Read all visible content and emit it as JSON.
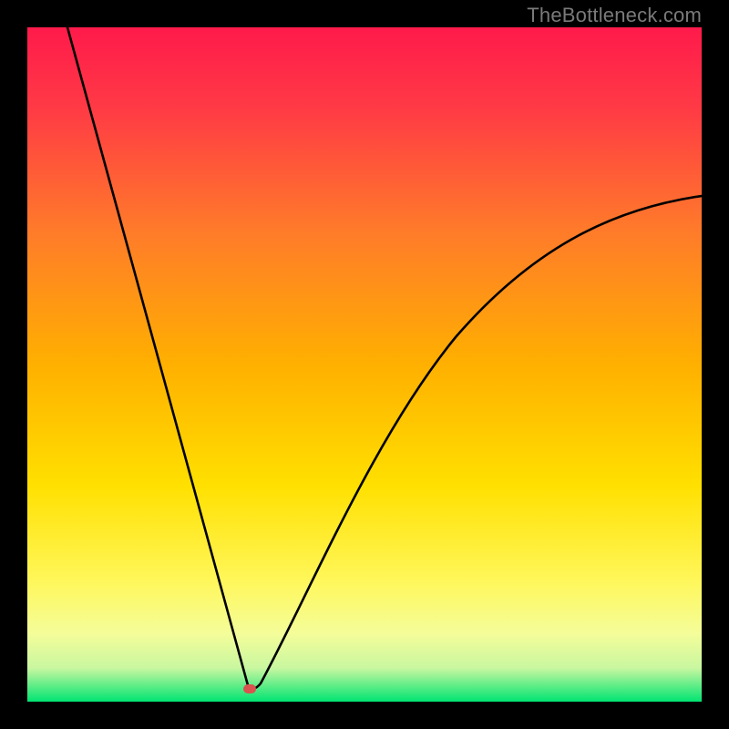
{
  "watermark": "TheBottleneck.com",
  "chart_data": {
    "type": "line",
    "title": "",
    "xlabel": "",
    "ylabel": "",
    "xlim": [
      0,
      100
    ],
    "ylim": [
      0,
      100
    ],
    "gradient_colors": {
      "top": "#ff1a4b",
      "mid_upper": "#ff7a2a",
      "mid": "#ffd400",
      "lower": "#fff75a",
      "band": "#eefcaa",
      "bottom": "#00e472"
    },
    "curve": {
      "description": "Asymmetric V-shaped bottleneck curve: steep linear drop from top-left to a sharp minimum near x≈33, then concave rise toward an asymptote well below 100 on the right.",
      "left_branch": {
        "x": [
          6,
          33.3
        ],
        "y": [
          100,
          2
        ],
        "shape": "linear"
      },
      "right_branch": {
        "x": [
          33.3,
          100
        ],
        "y": [
          2,
          75
        ],
        "shape": "concave-asymptotic"
      },
      "minimum": {
        "x": 33.3,
        "y": 2
      }
    },
    "marker": {
      "x": 33,
      "y": 2,
      "color": "#d9534f",
      "shape": "rounded-rect"
    }
  }
}
